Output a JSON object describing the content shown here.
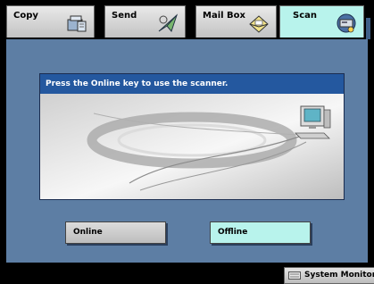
{
  "tabs": [
    {
      "label": "Copy",
      "icon": "copy-icon",
      "active": false
    },
    {
      "label": "Send",
      "icon": "send-icon",
      "active": false
    },
    {
      "label": "Mail Box",
      "icon": "mailbox-icon",
      "active": false
    },
    {
      "label": "Scan",
      "icon": "scanner-icon",
      "active": true
    }
  ],
  "panel": {
    "message": "Press the Online key to use the scanner."
  },
  "buttons": {
    "online": "Online",
    "offline": "Offline",
    "selected": "Offline"
  },
  "footer": {
    "system_monitor": "System Monitor"
  },
  "colors": {
    "background": "#5d7ea4",
    "header": "#24589f",
    "active_tab": "#b8f3ec",
    "tab": "#c9c9c9"
  }
}
